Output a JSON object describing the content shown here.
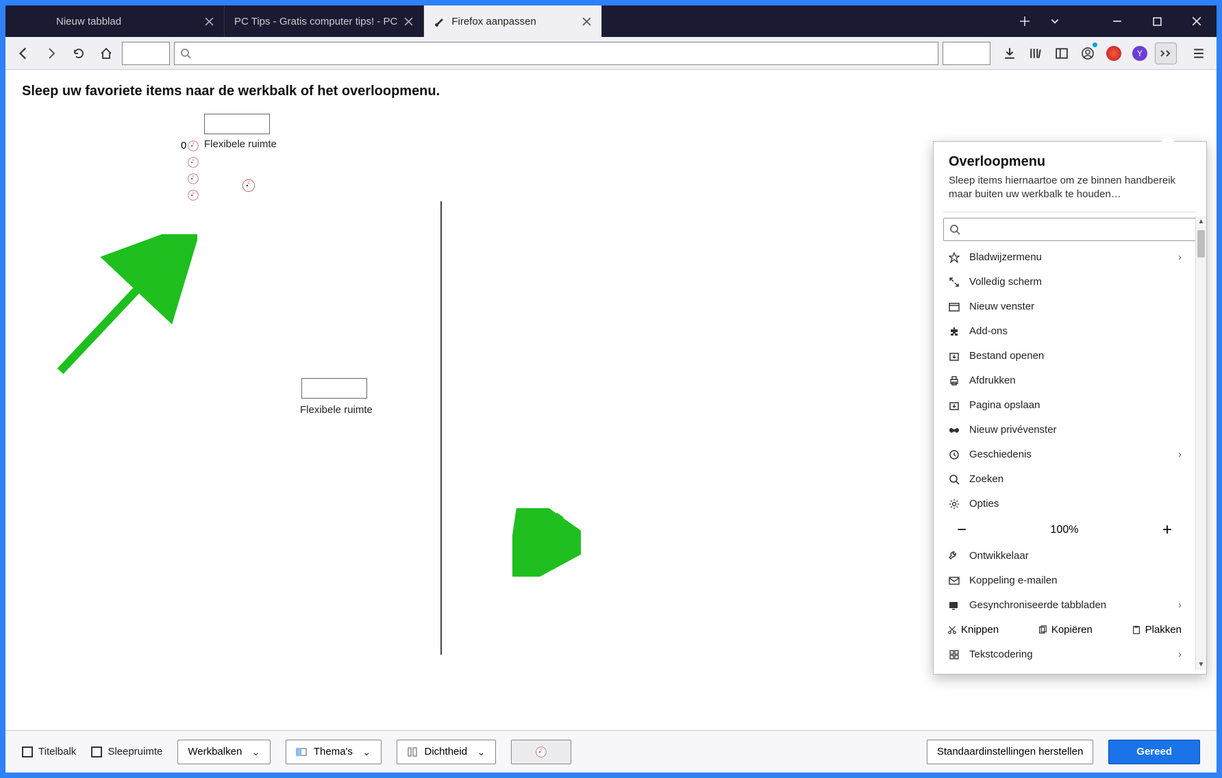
{
  "tabs": [
    {
      "title": "Nieuw tabblad",
      "active": false
    },
    {
      "title": "PC Tips - Gratis computer tips! - PC",
      "active": false
    },
    {
      "title": "Firefox aanpassen",
      "active": true
    }
  ],
  "palette_heading": "Sleep uw favoriete items naar de werkbalk of het overloopmenu.",
  "flex_label_1": "Flexibele ruimte",
  "flex_label_2": "Flexibele ruimte",
  "overflow": {
    "title": "Overloopmenu",
    "subtitle": "Sleep items hiernaartoe om ze binnen handbereik maar buiten uw werkbalk te houden…",
    "items": [
      {
        "label": "Bladwijzermenu",
        "chevron": true
      },
      {
        "label": "Volledig scherm",
        "chevron": false
      },
      {
        "label": "Nieuw venster",
        "chevron": false
      },
      {
        "label": "Add-ons",
        "chevron": false
      },
      {
        "label": "Bestand openen",
        "chevron": false
      },
      {
        "label": "Afdrukken",
        "chevron": false
      },
      {
        "label": "Pagina opslaan",
        "chevron": false
      },
      {
        "label": "Nieuw privévenster",
        "chevron": false
      },
      {
        "label": "Geschiedenis",
        "chevron": true
      },
      {
        "label": "Zoeken",
        "chevron": false
      },
      {
        "label": "Opties",
        "chevron": false
      }
    ],
    "zoom_level": "100%",
    "after_zoom": [
      {
        "label": "Ontwikkelaar",
        "chevron": false
      },
      {
        "label": "Koppeling e-mailen",
        "chevron": false
      },
      {
        "label": "Gesynchroniseerde tabbladen",
        "chevron": true
      }
    ],
    "clipboard": {
      "cut": "Knippen",
      "copy": "Kopiëren",
      "paste": "Plakken"
    },
    "last_item": {
      "label": "Tekstcodering",
      "chevron": true
    }
  },
  "footer": {
    "titlebar": "Titelbalk",
    "dragspace": "Sleepruimte",
    "toolbars": "Werkbalken",
    "themes": "Thema's",
    "density": "Dichtheid",
    "restore": "Standaardinstellingen herstellen",
    "done": "Gereed"
  },
  "stray_text": "0"
}
